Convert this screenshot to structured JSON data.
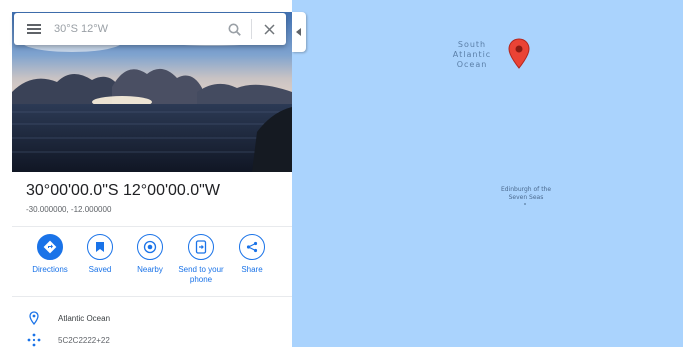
{
  "search": {
    "value": "30°S 12°W"
  },
  "place": {
    "title": "30°00'00.0\"S 12°00'00.0\"W",
    "coords": "-30.000000, -12.000000"
  },
  "actions": [
    {
      "label": "Directions",
      "icon": "directions-icon"
    },
    {
      "label": "Saved",
      "icon": "bookmark-icon"
    },
    {
      "label": "Nearby",
      "icon": "nearby-icon"
    },
    {
      "label": "Send to your phone",
      "icon": "send-to-phone-icon"
    },
    {
      "label": "Share",
      "icon": "share-icon"
    }
  ],
  "info": {
    "location": "Atlantic Ocean",
    "plus_code": "5C2C2222+22"
  },
  "map": {
    "ocean_label": "South Atlantic Ocean",
    "island_label": "Edinburgh of the Seven Seas"
  },
  "colors": {
    "accent": "#1a73e8",
    "water": "#aad3fd",
    "pin": "#ea4335"
  }
}
